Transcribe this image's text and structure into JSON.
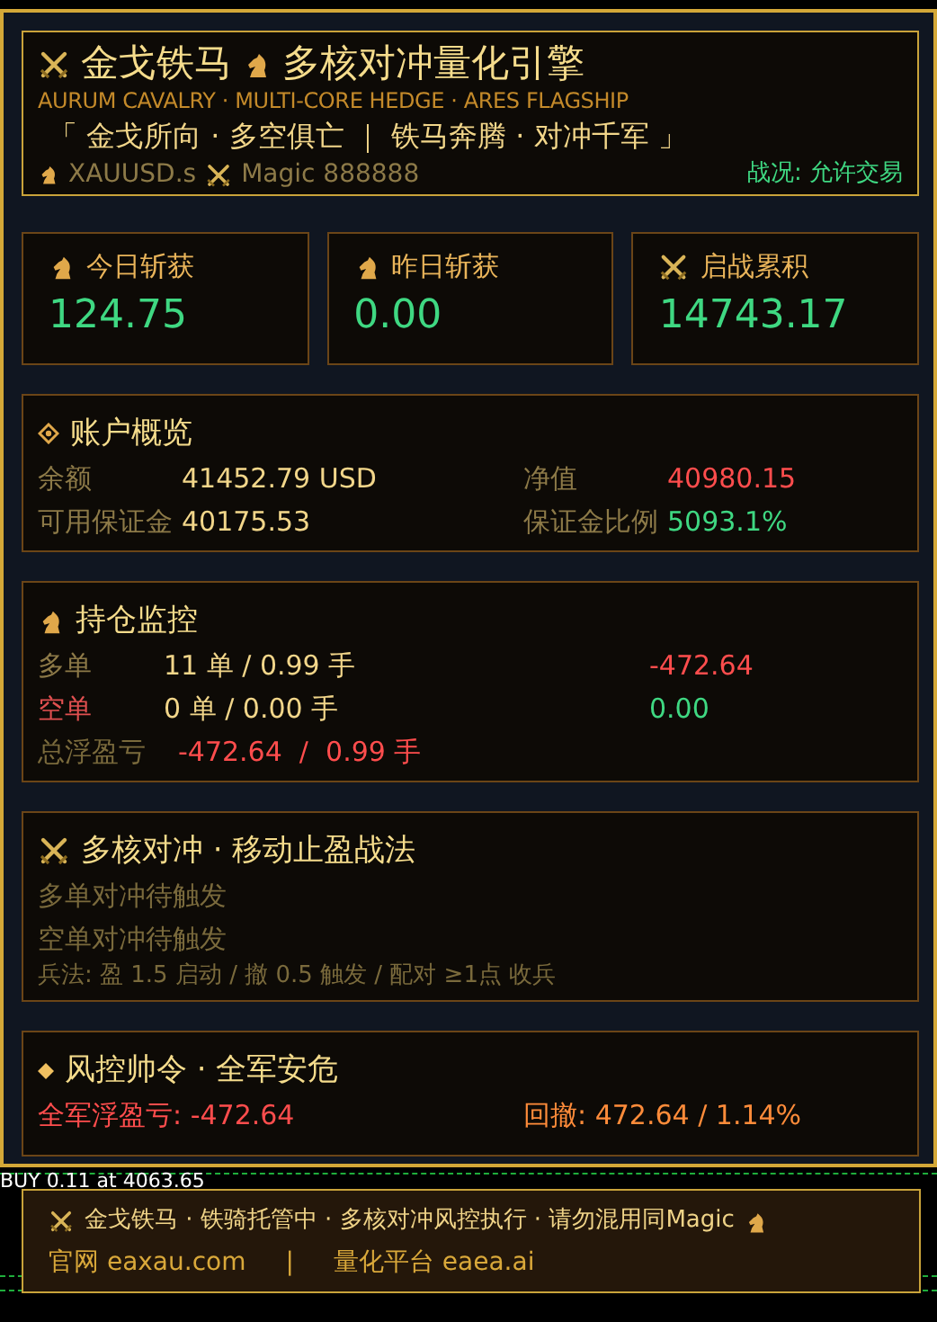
{
  "header": {
    "title_left": "金戈铁马",
    "title_right": "多核对冲量化引擎",
    "subtitle": "AURUM CAVALRY · MULTI-CORE HEDGE · ARES FLAGSHIP",
    "motto": "「 金戈所向 · 多空俱亡 ｜ 铁马奔腾 · 对冲千军 」",
    "symbol": "XAUUSD.s",
    "magic": "Magic 888888",
    "status": "战况: 允许交易",
    "trading_allowed": true
  },
  "stats": [
    {
      "kind": "horse",
      "label": "今日斩获",
      "value": "124.75",
      "color": "#3fd882"
    },
    {
      "kind": "horse",
      "label": "昨日斩获",
      "value": "0.00",
      "color": "#3fd882"
    },
    {
      "kind": "swords",
      "label": "启战累积",
      "value": "14743.17",
      "color": "#3fd882"
    }
  ],
  "account": {
    "title": "账户概览",
    "fields": [
      {
        "label": "余额",
        "value": "41452.79 USD",
        "color": "#f2d68a"
      },
      {
        "label": "净值",
        "value": "40980.15",
        "color": "#ff4d4d"
      },
      {
        "label": "可用保证金",
        "value": "40175.53",
        "color": "#f2d68a"
      },
      {
        "label": "保证金比例",
        "value": "5093.1%",
        "color": "#3fd882"
      }
    ]
  },
  "positions": {
    "title": "持仓监控",
    "rows": [
      {
        "label": {
          "text": "多单",
          "color": "#8d7a48"
        },
        "value": "11 单 / 0.99 手",
        "pnl": "-472.64",
        "color": "#ff4d4d"
      },
      {
        "label": {
          "text": "空单",
          "color": "#e05050"
        },
        "value": "0 单 / 0.00 手",
        "pnl": "0.00",
        "color": "#3fd882"
      }
    ],
    "total": {
      "label": "总浮盈亏",
      "value": "-472.64  /  0.99 手",
      "color": "#ff4d4d"
    }
  },
  "hedge": {
    "title": "多核对冲 · 移动止盈战法",
    "lines": [
      "多单对冲待触发",
      "空单对冲待触发"
    ],
    "rule": "兵法: 盈 1.5 启动 / 撤 0.5 触发 / 配对 ≥1点 收兵"
  },
  "risk": {
    "title": "风控帅令 · 全军安危",
    "float_pnl": {
      "text": "全军浮盈亏: -472.64",
      "color": "#ff4d4d"
    },
    "drawdown": "回撤: 472.64 / 1.14%"
  },
  "chart": {
    "order_label": "BUY 0.11 at 4063.65"
  },
  "footer": {
    "notice": "金戈铁马 · 铁骑托管中 · 多核对冲风控执行 · 请勿混用同Magic",
    "links": [
      "官网 eaxau.com",
      "量化平台 eaea.ai"
    ],
    "separator": "|"
  }
}
